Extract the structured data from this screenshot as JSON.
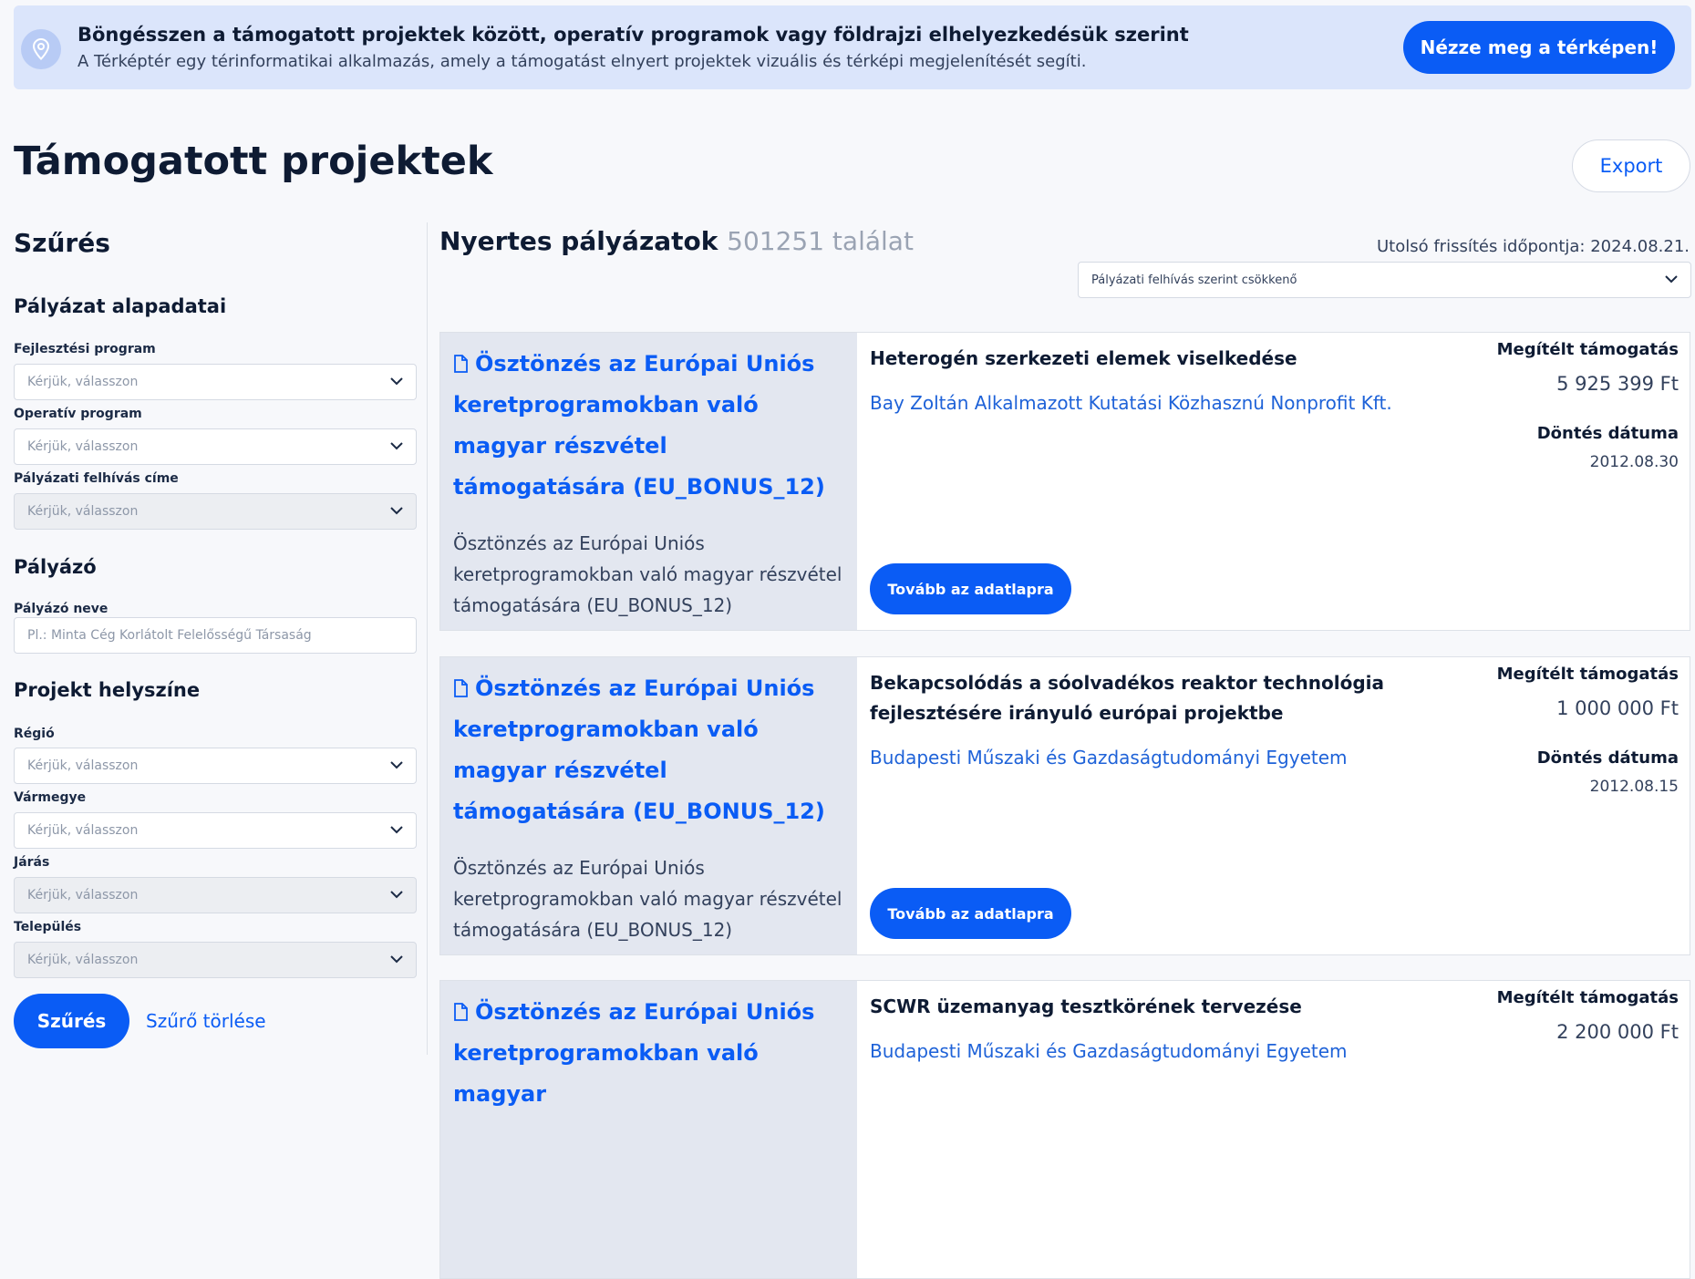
{
  "banner": {
    "title": "Böngésszen a támogatott projektek között, operatív programok vagy földrajzi elhelyezkedésük szerint",
    "subtitle": "A Térképtér egy térinformatikai alkalmazás, amely a támogatást elnyert projektek vizuális és térképi megjelenítését segíti.",
    "map_button": "Nézze meg a térképen!"
  },
  "page": {
    "title": "Támogatott projektek",
    "export_label": "Export"
  },
  "sidebar": {
    "heading": "Szűrés",
    "basic_section": "Pályázat alapadatai",
    "dev_program_label": "Fejlesztési program",
    "op_program_label": "Operatív program",
    "call_title_label": "Pályázati felhívás címe",
    "applicant_section": "Pályázó",
    "applicant_name_label": "Pályázó neve",
    "applicant_name_placeholder": "Pl.: Minta Cég Korlátolt Felelősségű Társaság",
    "location_section": "Projekt helyszíne",
    "region_label": "Régió",
    "county_label": "Vármegye",
    "district_label": "Járás",
    "settlement_label": "Település",
    "select_placeholder": "Kérjük, válasszon",
    "filter_button": "Szűrés",
    "clear_link": "Szűrő törlése"
  },
  "results": {
    "title": "Nyertes pályázatok",
    "count": "501251 találat",
    "last_update": "Utolsó frissítés időpontja: 2024.08.21.",
    "sort_value": "Pályázati felhívás szerint csökkenő"
  },
  "labels": {
    "awarded": "Megítélt támogatás",
    "decision_date": "Döntés dátuma",
    "more_button": "Tovább az adatlapra"
  },
  "cards": [
    {
      "call": "Ösztönzés az Európai Uniós keretprogramokban való magyar részvétel támogatására (EU_BONUS_12)",
      "call_desc": "Ösztönzés az Európai Uniós keretprogramokban való magyar részvétel támogatására (EU_BONUS_12)",
      "title": "Heterogén szerkezeti elemek viselkedése",
      "org": "Bay Zoltán Alkalmazott Kutatási Közhasznú Nonprofit Kft.",
      "amount": "5 925 399 Ft",
      "date": "2012.08.30"
    },
    {
      "call": "Ösztönzés az Európai Uniós keretprogramokban való magyar részvétel támogatására (EU_BONUS_12)",
      "call_desc": "Ösztönzés az Európai Uniós keretprogramokban való magyar részvétel támogatására (EU_BONUS_12)",
      "title": "Bekapcsolódás a sóolvadékos reaktor technológia fejlesztésére irányuló európai projektbe",
      "org": "Budapesti Műszaki és Gazdaságtudományi Egyetem",
      "amount": "1 000 000 Ft",
      "date": "2012.08.15"
    },
    {
      "call": "Ösztönzés az Európai Uniós keretprogramokban való magyar",
      "title": "SCWR üzemanyag tesztkörének tervezése",
      "org": "Budapesti Műszaki és Gazdaságtudományi Egyetem",
      "amount": "2 200 000 Ft"
    }
  ],
  "colors": {
    "primary": "#0a5cf5",
    "banner_bg": "#dbe5fb",
    "card_left_bg": "#e3e7f0"
  }
}
